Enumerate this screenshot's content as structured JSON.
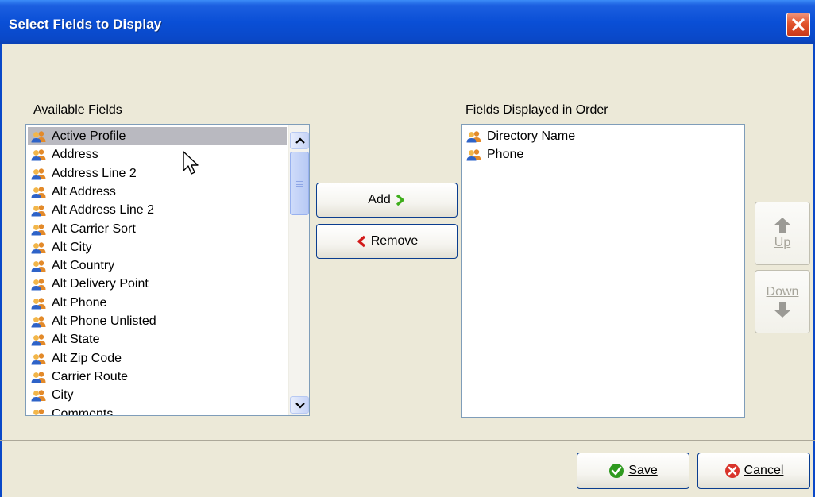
{
  "window": {
    "title": "Select Fields to Display"
  },
  "available": {
    "label": "Available Fields",
    "items": [
      "Active Profile",
      "Address",
      "Address Line 2",
      "Alt Address",
      "Alt Address Line 2",
      "Alt Carrier Sort",
      "Alt City",
      "Alt Country",
      "Alt Delivery Point",
      "Alt Phone",
      "Alt Phone Unlisted",
      "Alt State",
      "Alt Zip Code",
      "Carrier Route",
      "City",
      "Comments"
    ],
    "selected": "Active Profile"
  },
  "displayed": {
    "label": "Fields Displayed in Order",
    "items": [
      "Directory Name",
      "Phone"
    ]
  },
  "buttons": {
    "add": "Add",
    "remove": "Remove",
    "up": "Up",
    "down": "Down",
    "save": "Save",
    "cancel": "Cancel"
  },
  "icons": {
    "field": "users-icon",
    "add": "chevron-right-icon",
    "remove": "chevron-left-icon",
    "up": "arrow-up-icon",
    "down": "arrow-down-icon",
    "save": "check-icon",
    "cancel": "cancel-icon",
    "close": "close-icon"
  },
  "colors": {
    "titlebar": "#0a4fd6",
    "add_arrow": "#3fae1c",
    "remove_arrow": "#d21a1a",
    "save_icon": "#2f9a1f",
    "cancel_icon": "#d9342b"
  }
}
